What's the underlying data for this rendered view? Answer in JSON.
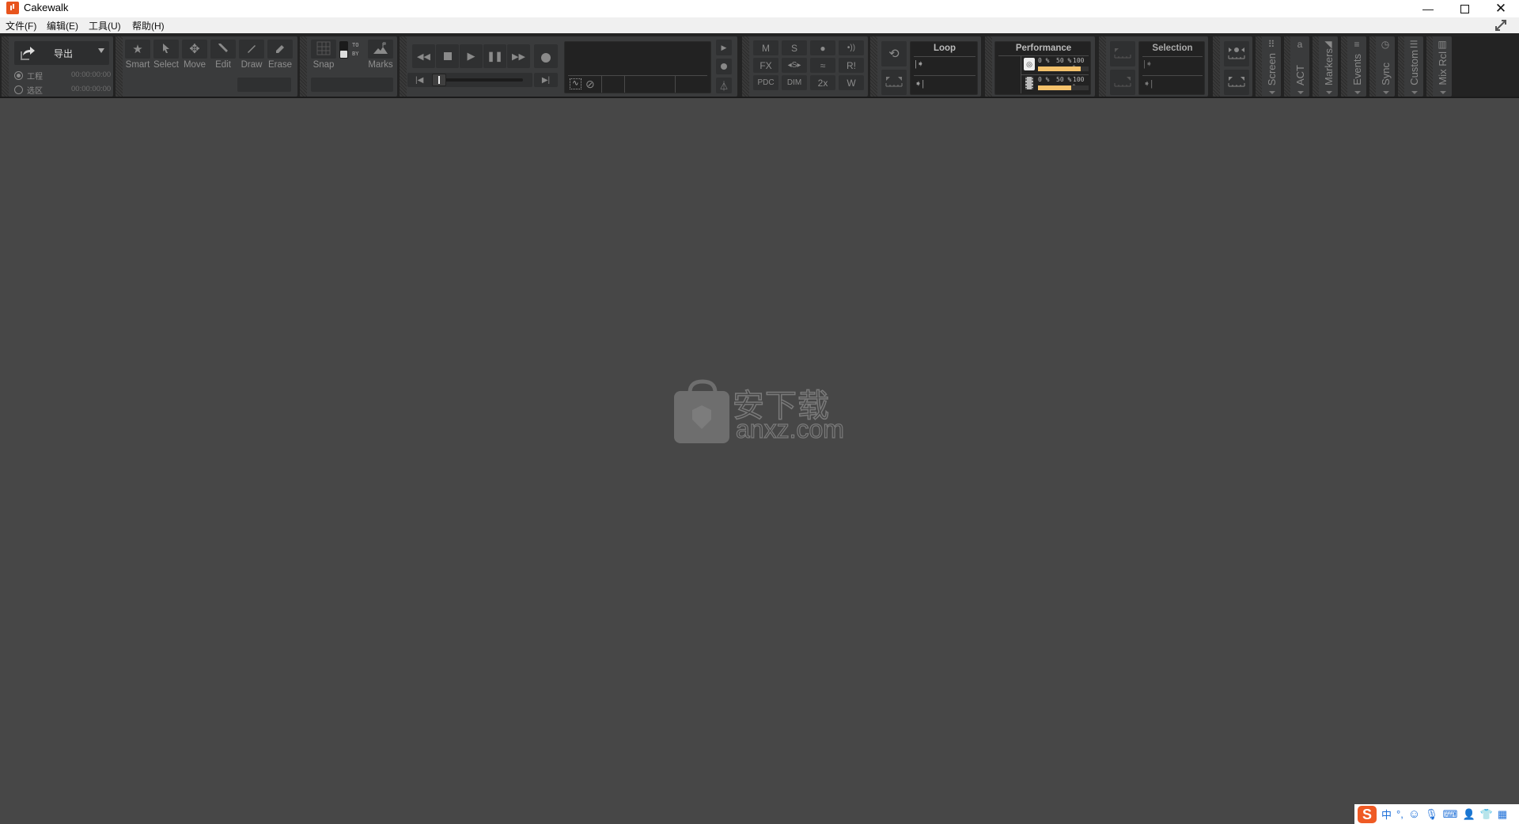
{
  "window": {
    "title": "Cakewalk",
    "minimize_icon": "minimize-icon",
    "maximize_icon": "maximize-icon",
    "close_icon": "close-icon"
  },
  "menu": {
    "items": [
      {
        "label": "文件(F)"
      },
      {
        "label": "编辑(E)"
      },
      {
        "label": "工具(U)"
      },
      {
        "label": "帮助(H)"
      }
    ],
    "fullscreen_icon": "expand-icon"
  },
  "export_panel": {
    "export_label": "导出",
    "options": [
      {
        "label": "工程",
        "time": "00:00:00:00",
        "selected": true
      },
      {
        "label": "选区",
        "time": "00:00:00:00",
        "selected": false
      }
    ]
  },
  "tools_panel": {
    "tools": [
      {
        "label": "Smart",
        "icon": "star-icon"
      },
      {
        "label": "Select",
        "icon": "cursor-icon"
      },
      {
        "label": "Move",
        "icon": "move-icon"
      },
      {
        "label": "Edit",
        "icon": "wrench-icon"
      },
      {
        "label": "Draw",
        "icon": "pencil-icon"
      },
      {
        "label": "Erase",
        "icon": "eraser-icon"
      }
    ]
  },
  "snap_panel": {
    "snap_label": "Snap",
    "to_label": "TO",
    "by_label": "BY",
    "marks_label": "Marks"
  },
  "transport": {
    "buttons": [
      "rewind",
      "stop",
      "play",
      "pause",
      "fast-forward"
    ],
    "position": 0
  },
  "mix_panel": {
    "buttons": [
      {
        "label": "M"
      },
      {
        "label": "S"
      },
      {
        "label": "●"
      },
      {
        "label": "•))"
      },
      {
        "label": "FX"
      },
      {
        "label": "◂S▸"
      },
      {
        "label": "≈"
      },
      {
        "label": "R!"
      },
      {
        "label": "PDC"
      },
      {
        "label": "DIM"
      },
      {
        "label": "2x"
      },
      {
        "label": "W"
      }
    ]
  },
  "loop_panel": {
    "title": "Loop"
  },
  "performance_panel": {
    "title": "Performance",
    "meters": [
      {
        "name": "disk",
        "icon": "disk-icon",
        "scale": [
          "0 %",
          "50 %",
          "100 %"
        ],
        "value_percent": 84
      },
      {
        "name": "memory",
        "icon": "chip-icon",
        "scale": [
          "0 %",
          "50 %",
          "100 %"
        ],
        "value_percent": 66
      }
    ],
    "bar_color": "#f5c26b"
  },
  "selection_panel": {
    "title": "Selection"
  },
  "side_modules": [
    {
      "label": "Screen",
      "icon": "grid-dots-icon"
    },
    {
      "label": "ACT",
      "icon": "act-icon"
    },
    {
      "label": "Markers",
      "icon": "marker-flag-icon"
    },
    {
      "label": "Events",
      "icon": "events-icon"
    },
    {
      "label": "Sync",
      "icon": "clock-icon"
    },
    {
      "label": "Custom",
      "icon": "list-icon"
    },
    {
      "label": "Mix Rcl",
      "icon": "mixer-icon"
    }
  ],
  "watermark": {
    "cn": "安下载",
    "url": "anxz.com"
  },
  "ime": {
    "logo": "S",
    "mode": "中",
    "punct": "°,",
    "emoji": "☺"
  }
}
